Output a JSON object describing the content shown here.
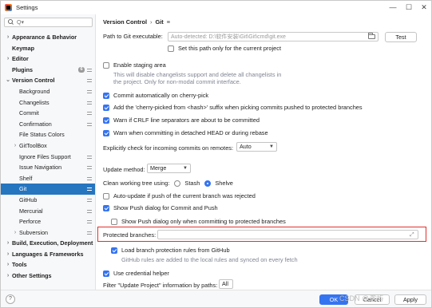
{
  "window": {
    "title": "Settings",
    "minimize_glyph": "—",
    "maximize_glyph": "☐",
    "close_glyph": "✕"
  },
  "search": {
    "placeholder": "Q▾",
    "value": ""
  },
  "sidebar": {
    "items": [
      {
        "label": "Appearance & Behavior",
        "arrow": "›",
        "bold": true,
        "level": 0
      },
      {
        "label": "Keymap",
        "arrow": "",
        "bold": true,
        "level": 0
      },
      {
        "label": "Editor",
        "arrow": "›",
        "bold": true,
        "level": 0
      },
      {
        "label": "Plugins",
        "arrow": "",
        "bold": true,
        "level": 0,
        "badge": "6",
        "project_icon": true
      },
      {
        "label": "Version Control",
        "arrow": "⌄",
        "bold": true,
        "level": 0,
        "project_icon": true
      },
      {
        "label": "Background",
        "arrow": "",
        "level": 1,
        "project_icon": true
      },
      {
        "label": "Changelists",
        "arrow": "",
        "level": 1,
        "project_icon": true
      },
      {
        "label": "Commit",
        "arrow": "",
        "level": 1,
        "project_icon": true
      },
      {
        "label": "Confirmation",
        "arrow": "",
        "level": 1,
        "project_icon": true
      },
      {
        "label": "File Status Colors",
        "arrow": "",
        "level": 1
      },
      {
        "label": "GitToolBox",
        "arrow": "›",
        "level": 1
      },
      {
        "label": "Ignore Files Support",
        "arrow": "",
        "level": 1,
        "project_icon": true
      },
      {
        "label": "Issue Navigation",
        "arrow": "",
        "level": 1,
        "project_icon": true
      },
      {
        "label": "Shelf",
        "arrow": "",
        "level": 1,
        "project_icon": true
      },
      {
        "label": "Git",
        "arrow": "",
        "level": 1,
        "project_icon": true,
        "selected": true
      },
      {
        "label": "GitHub",
        "arrow": "",
        "level": 1,
        "project_icon": true
      },
      {
        "label": "Mercurial",
        "arrow": "",
        "level": 1,
        "project_icon": true
      },
      {
        "label": "Perforce",
        "arrow": "",
        "level": 1,
        "project_icon": true
      },
      {
        "label": "Subversion",
        "arrow": "›",
        "level": 1,
        "project_icon": true
      },
      {
        "label": "Build, Execution, Deployment",
        "arrow": "›",
        "bold": true,
        "level": 0
      },
      {
        "label": "Languages & Frameworks",
        "arrow": "›",
        "bold": true,
        "level": 0
      },
      {
        "label": "Tools",
        "arrow": "›",
        "bold": true,
        "level": 0
      },
      {
        "label": "Other Settings",
        "arrow": "›",
        "bold": true,
        "level": 0
      }
    ]
  },
  "breadcrumb": {
    "parent": "Version Control",
    "separator": "›",
    "current": "Git",
    "icon": "≡"
  },
  "git_path": {
    "label": "Path to Git executable:",
    "placeholder": "Auto-detected: D:\\软件安装\\Git\\Git\\cmd\\git.exe",
    "test_button": "Test",
    "set_for_project": "Set this path only for the current project"
  },
  "staging": {
    "label": "Enable staging area",
    "hint_line1": "This will disable changelists support and delete all changelists in",
    "hint_line2": "the project. Only for non-modal commit interface."
  },
  "commit_options": [
    {
      "label": "Commit automatically on cherry-pick",
      "checked": true
    },
    {
      "label": "Add the 'cherry-picked from <hash>' suffix when picking commits pushed to protected branches",
      "checked": true
    },
    {
      "label": "Warn if CRLF line separators are about to be committed",
      "checked": true
    },
    {
      "label": "Warn when committing in detached HEAD or during rebase",
      "checked": true
    }
  ],
  "incoming": {
    "label": "Explicitly check for incoming commits on remotes:",
    "value": "Auto"
  },
  "update_method": {
    "label": "Update method:",
    "value": "Merge"
  },
  "clean_tree": {
    "label": "Clean working tree using:",
    "option1": "Stash",
    "option2": "Shelve",
    "selected": "Shelve"
  },
  "auto_update": {
    "label": "Auto-update if push of the current branch was rejected",
    "checked": false
  },
  "push_dialog": {
    "label": "Show Push dialog for Commit and Push",
    "checked": true
  },
  "push_protected": {
    "label": "Show Push dialog only when committing to protected branches",
    "checked": false
  },
  "protected_branches": {
    "label": "Protected branches:",
    "value": ""
  },
  "load_rules": {
    "label": "Load branch protection rules from GitHub",
    "checked": true,
    "hint": "GitHub rules are added to the local rules and synced on every fetch"
  },
  "credential_helper": {
    "label": "Use credential helper",
    "checked": true
  },
  "filter_update": {
    "label": "Filter \"Update Project\" information by paths:",
    "value": "All"
  },
  "footer": {
    "help": "?",
    "ok": "OK",
    "cancel": "Cancel",
    "apply": "Apply"
  },
  "watermark": "CSDN @漱屿",
  "colors": {
    "accent": "#3574f0",
    "selection": "#2675bf",
    "highlight_border": "#e0302c"
  }
}
